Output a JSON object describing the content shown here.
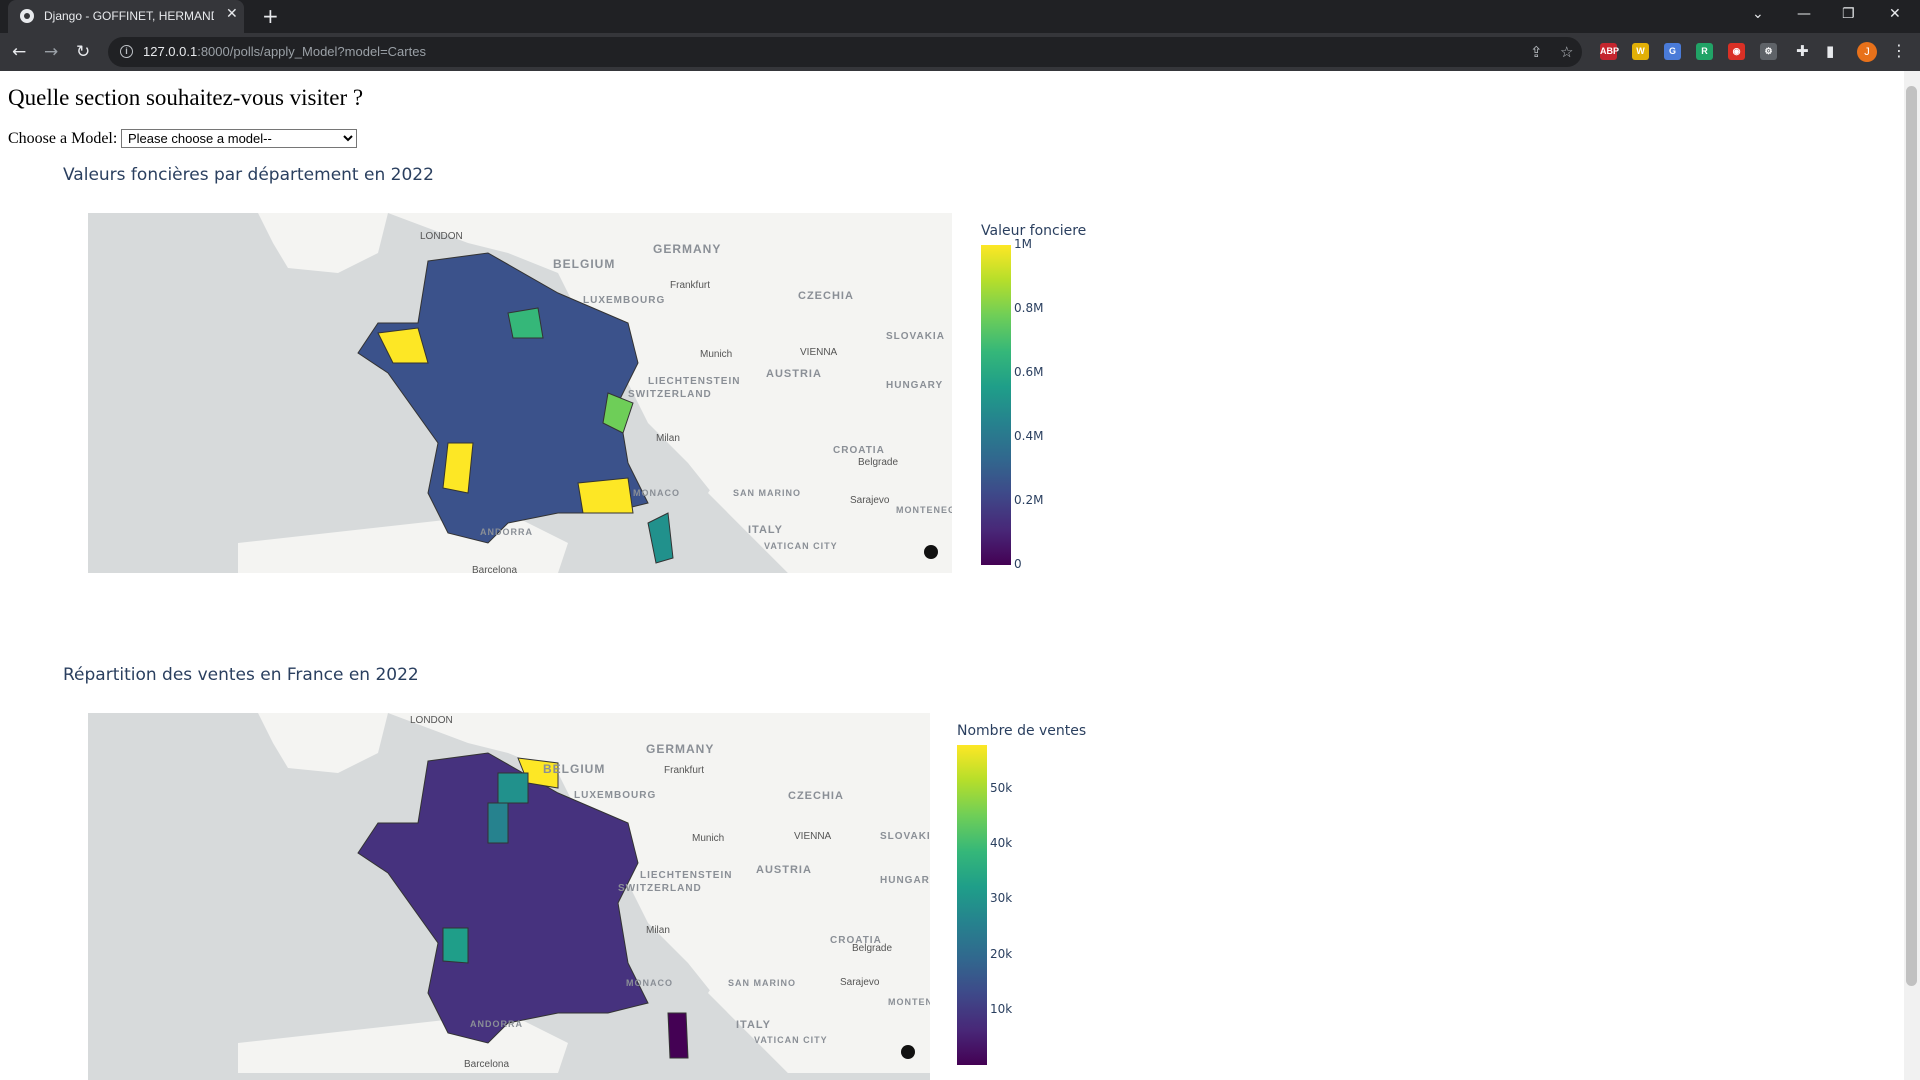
{
  "browser": {
    "tab_title": "Django - GOFFINET, HERMAND,",
    "tab_close": "✕",
    "new_tab": "+",
    "url_host": "127.0.0.1",
    "url_rest": ":8000/polls/apply_Model?model=Cartes",
    "profile_initial": "J",
    "extensions": [
      {
        "label": "ABP",
        "color": "#c4262e"
      },
      {
        "label": "W",
        "color": "#e2b007"
      },
      {
        "label": "G",
        "color": "#4a7bd8"
      },
      {
        "label": "R",
        "color": "#21a366"
      },
      {
        "label": "◉",
        "color": "#d93025"
      },
      {
        "label": "⚙",
        "color": "#5f6368"
      }
    ]
  },
  "page": {
    "heading": "Quelle section souhaitez-vous visiter ?",
    "chooser_label": "Choose a Model:",
    "select_value": "Please choose a model--"
  },
  "map_labels": {
    "countries": [
      "GERMANY",
      "BELGIUM",
      "CZECHIA",
      "SLOVAKIA",
      "AUSTRIA",
      "HUNGARY",
      "CROATIA",
      "ITALY",
      "SAN MARINO",
      "MONTENEGRO",
      "LIECHTENSTEIN",
      "SWITZERLAND",
      "LUXEMBOURG",
      "VATICAN CITY",
      "ANDORRA",
      "MONACO"
    ],
    "cities": [
      "LONDON",
      "Frankfurt",
      "Munich",
      "VIENNA",
      "Milan",
      "Belgrade",
      "Sarajevo",
      "Barcelona"
    ]
  },
  "chart_data": [
    {
      "type": "heatmap",
      "title": "Valeurs foncières par département en 2022",
      "colorbar_title": "Valeur fonciere",
      "colorscale": "Viridis",
      "range": [
        0,
        1000000
      ],
      "ticks": [
        "0",
        "0.2M",
        "0.4M",
        "0.6M",
        "0.8M",
        "1M"
      ],
      "tick_values": [
        0,
        200000,
        400000,
        600000,
        800000,
        1000000
      ]
    },
    {
      "type": "heatmap",
      "title": "Répartition des ventes en France en 2022",
      "colorbar_title": "Nombre de ventes",
      "colorscale": "Viridis",
      "range": [
        0,
        58000
      ],
      "ticks": [
        "10k",
        "20k",
        "30k",
        "40k",
        "50k"
      ],
      "tick_values": [
        10000,
        20000,
        30000,
        40000,
        50000
      ]
    }
  ]
}
